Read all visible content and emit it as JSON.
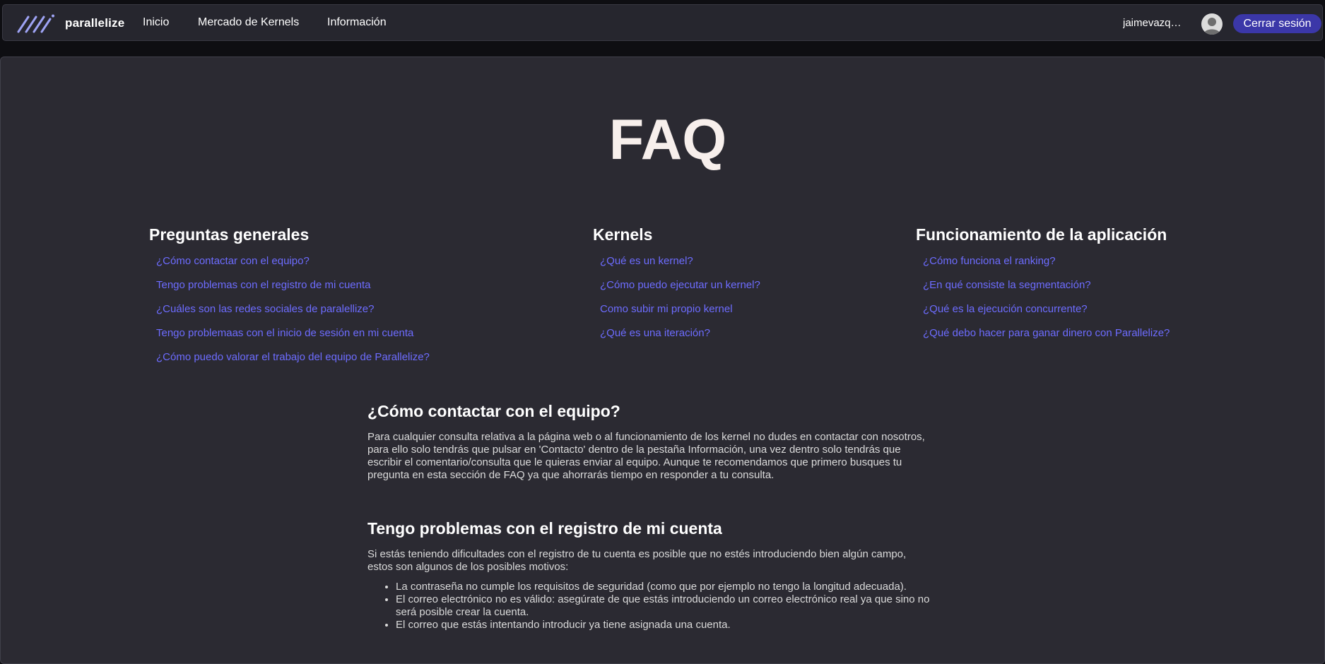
{
  "header": {
    "logo_text": "parallelize",
    "nav": [
      "Inicio",
      "Mercado de Kernels",
      "Información"
    ],
    "username": "jaimevazq…",
    "logout_label": "Cerrar sesión"
  },
  "page_title": "FAQ",
  "columns": [
    {
      "title": "Preguntas generales",
      "links": [
        "¿Cómo contactar con el equipo?",
        "Tengo problemas con el registro de mi cuenta",
        "¿Cuáles son las redes sociales de paralellize?",
        "Tengo problemaas con el inicio de sesión en mi cuenta",
        "¿Cómo puedo valorar el trabajo del equipo de Parallelize?"
      ]
    },
    {
      "title": "Kernels",
      "links": [
        "¿Qué es un kernel?",
        "¿Cómo puedo ejecutar un kernel?",
        "Como subir mi propio kernel",
        "¿Qué es una iteración?"
      ]
    },
    {
      "title": "Funcionamiento de la aplicación",
      "links": [
        "¿Cómo funciona el ranking?",
        "¿En qué consiste la segmentación?",
        "¿Qué es la ejecución concurrente?",
        "¿Qué debo hacer para ganar dinero con Parallelize?"
      ]
    }
  ],
  "articles": [
    {
      "title": "¿Cómo contactar con el equipo?",
      "lines": [
        "Para cualquier consulta relativa a la página web o al funcionamiento de los kernel no dudes en contactar con nosotros,",
        "para ello solo tendrás que pulsar en 'Contacto' dentro de la pestaña Información, una vez dentro solo tendrás que",
        "escribir el comentario/consulta que le quieras enviar al equipo. Aunque te recomendamos que primero busques tu",
        "pregunta en esta sección de FAQ ya que ahorrarás tiempo en responder a tu consulta."
      ]
    },
    {
      "title": "Tengo problemas con el registro de mi cuenta",
      "lines": [
        "Si estás teniendo dificultades con el registro de tu cuenta es posible que no estés introduciendo bien algún campo,",
        "estos son algunos de los posibles motivos:"
      ],
      "bullets": [
        [
          "La contraseña no cumple los requisitos de seguridad (como que por ejemplo no tengo la longitud adecuada)."
        ],
        [
          "El correo electrónico no es válido: asegúrate de que estás introduciendo un correo electrónico real ya que sino no",
          "será posible crear la cuenta."
        ],
        [
          "El correo que estás intentando introducir ya tiene asignada una cuenta."
        ]
      ]
    }
  ]
}
